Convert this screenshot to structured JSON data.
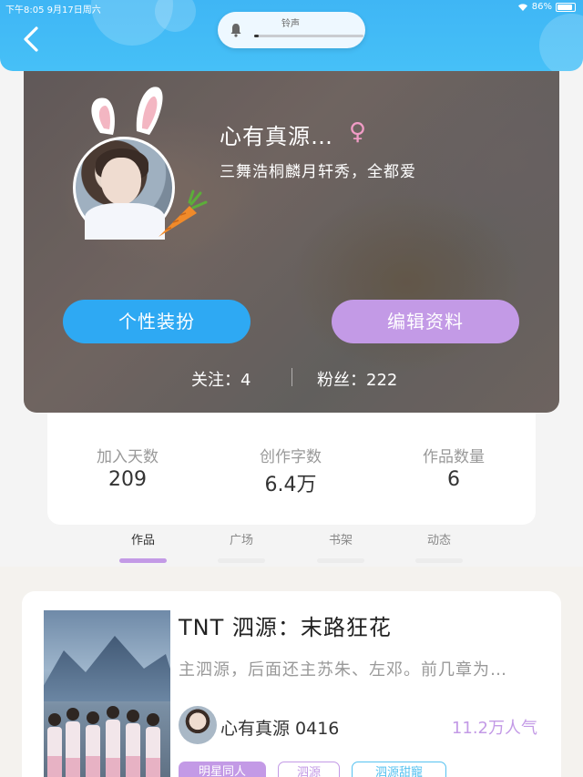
{
  "status_bar": {
    "time": "下午8:05",
    "date": "9月17日周六",
    "battery": "86%"
  },
  "ringer": {
    "label": "铃声",
    "level": 0.04
  },
  "profile": {
    "name": "心有真源…",
    "gender_symbol": "♀",
    "bio": "三舞浩桐麟月轩秀，全都爱",
    "dress_button": "个性装扮",
    "edit_button": "编辑资料",
    "follow": "关注：4",
    "fans": "粉丝：222"
  },
  "stats": [
    {
      "label": "加入天数",
      "value": "209"
    },
    {
      "label": "创作字数",
      "value": "6.4万"
    },
    {
      "label": "作品数量",
      "value": "6"
    }
  ],
  "tabs": [
    {
      "label": "作品",
      "active": true
    },
    {
      "label": "广场",
      "active": false
    },
    {
      "label": "书架",
      "active": false
    },
    {
      "label": "动态",
      "active": false
    }
  ],
  "work": {
    "title": "TNT 泗源：末路狂花",
    "description": "主泗源，后面还主苏朱、左邓。前几章为…",
    "author": "心有真源 0416",
    "popularity": "11.2万人气",
    "tags": [
      "明星同人",
      "泗源",
      "泗源甜寵"
    ]
  },
  "colors": {
    "header": "#46c0f7",
    "accent_purple": "#c39ae6",
    "accent_blue": "#2ea9f3"
  }
}
